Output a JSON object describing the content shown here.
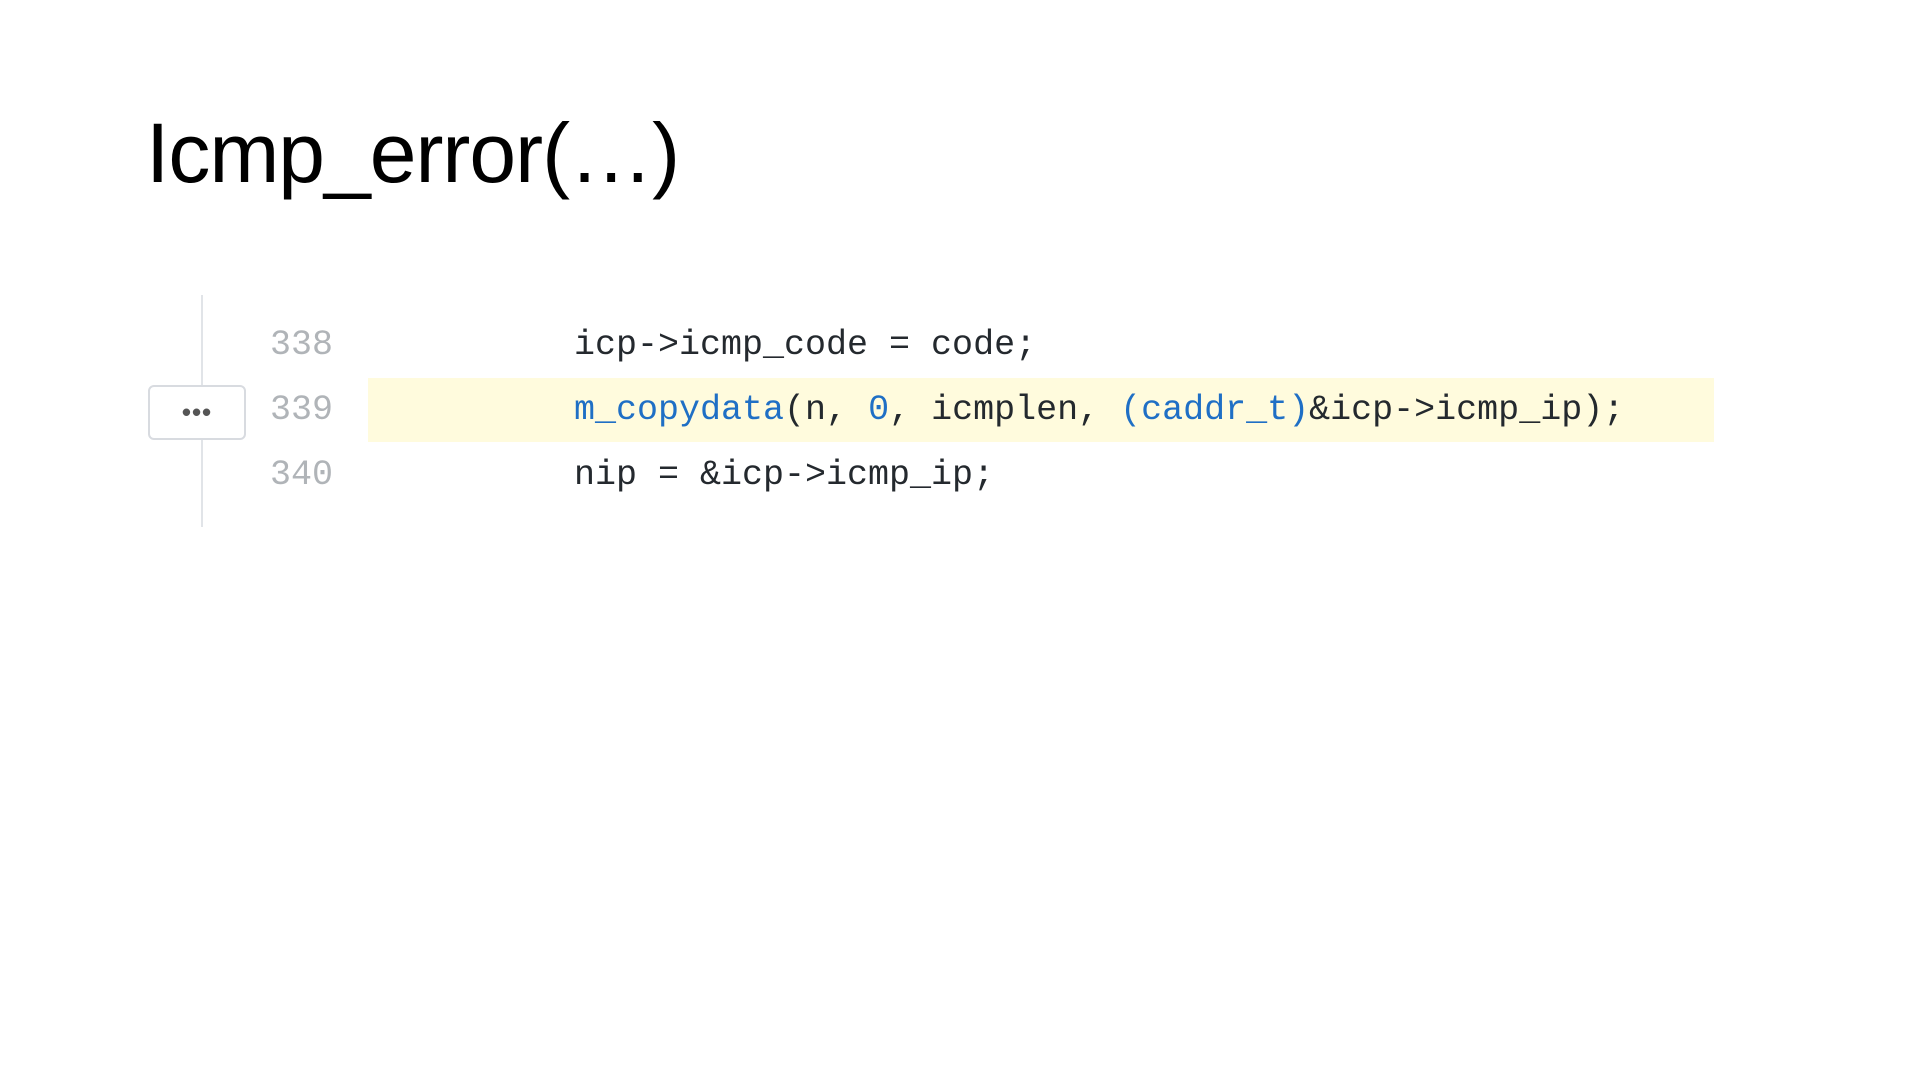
{
  "title": "Icmp_error(…)",
  "expand_button": "•••",
  "lines": [
    {
      "number": "338",
      "code": "icp->icmp_code = code;"
    },
    {
      "number": "339",
      "parts": [
        "m_copydata",
        "(n, ",
        "0",
        ", icmplen, ",
        "(caddr_t)",
        "&icp->icmp_ip);"
      ]
    },
    {
      "number": "340",
      "code": "nip = &icp->icmp_ip;"
    }
  ],
  "colors": {
    "highlight": "#fffbdd",
    "keyword": "#1f6fc5"
  }
}
